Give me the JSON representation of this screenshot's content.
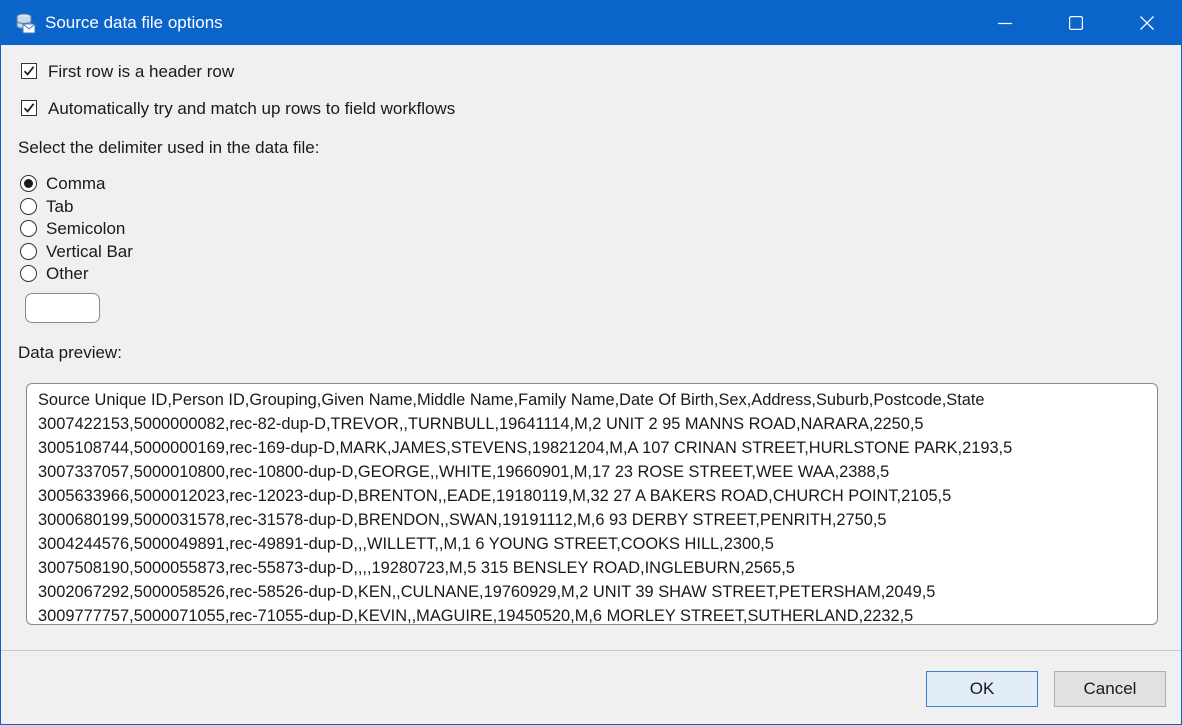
{
  "window": {
    "title": "Source data file options",
    "icon": "database-envelope-icon",
    "controls": [
      "minimize-icon",
      "maximize-icon",
      "close-icon"
    ],
    "accent_color": "#0a64ca"
  },
  "options": {
    "header_row": {
      "label": "First row is a header row",
      "checked": true
    },
    "auto_match": {
      "label": "Automatically try and match up rows to field workflows",
      "checked": true
    }
  },
  "delimiter": {
    "prompt": "Select the delimiter used in the data file:",
    "selected": "Comma",
    "options": [
      "Comma",
      "Tab",
      "Semicolon",
      "Vertical Bar",
      "Other"
    ],
    "other_value": ""
  },
  "preview": {
    "label": "Data preview:",
    "lines": [
      "Source Unique ID,Person ID,Grouping,Given Name,Middle Name,Family Name,Date Of Birth,Sex,Address,Suburb,Postcode,State",
      "3007422153,5000000082,rec-82-dup-D,TREVOR,,TURNBULL,19641114,M,2 UNIT 2 95 MANNS ROAD,NARARA,2250,5",
      "3005108744,5000000169,rec-169-dup-D,MARK,JAMES,STEVENS,19821204,M,A 107 CRINAN STREET,HURLSTONE PARK,2193,5",
      "3007337057,5000010800,rec-10800-dup-D,GEORGE,,WHITE,19660901,M,17 23 ROSE STREET,WEE WAA,2388,5",
      "3005633966,5000012023,rec-12023-dup-D,BRENTON,,EADE,19180119,M,32 27 A BAKERS ROAD,CHURCH POINT,2105,5",
      "3000680199,5000031578,rec-31578-dup-D,BRENDON,,SWAN,19191112,M,6 93 DERBY STREET,PENRITH,2750,5",
      "3004244576,5000049891,rec-49891-dup-D,,,WILLETT,,M,1 6 YOUNG STREET,COOKS HILL,2300,5",
      "3007508190,5000055873,rec-55873-dup-D,,,,19280723,M,5 315 BENSLEY ROAD,INGLEBURN,2565,5",
      "3002067292,5000058526,rec-58526-dup-D,KEN,,CULNANE,19760929,M,2 UNIT 39 SHAW STREET,PETERSHAM,2049,5",
      "3009777757,5000071055,rec-71055-dup-D,KEVIN,,MAGUIRE,19450520,M,6 MORLEY STREET,SUTHERLAND,2232,5"
    ]
  },
  "buttons": {
    "ok": "OK",
    "cancel": "Cancel"
  }
}
